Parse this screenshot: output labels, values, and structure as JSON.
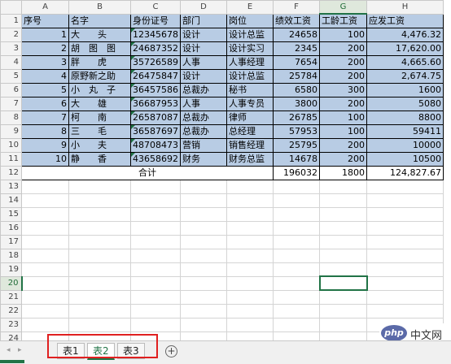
{
  "columns": [
    "A",
    "B",
    "C",
    "D",
    "E",
    "F",
    "G",
    "H"
  ],
  "header": [
    "序号",
    "名字",
    "身份证号",
    "部门",
    "岗位",
    "绩效工资",
    "工龄工资",
    "应发工资"
  ],
  "rows": [
    {
      "no": "1",
      "name": "大　　头",
      "id": "12345678",
      "dept": "设计",
      "post": "设计总监",
      "perf": "24658",
      "senior": "100",
      "pay": "4,476.32"
    },
    {
      "no": "2",
      "name": "胡　图　图",
      "id": "24687352",
      "dept": "设计",
      "post": "设计实习",
      "perf": "2345",
      "senior": "200",
      "pay": "17,620.00"
    },
    {
      "no": "3",
      "name": "胖　　虎",
      "id": "35726589",
      "dept": "人事",
      "post": "人事经理",
      "perf": "7654",
      "senior": "200",
      "pay": "4,665.60"
    },
    {
      "no": "4",
      "name": "原野新之助",
      "id": "26475847",
      "dept": "设计",
      "post": "设计总监",
      "perf": "25784",
      "senior": "200",
      "pay": "2,674.75"
    },
    {
      "no": "5",
      "name": "小　丸　子",
      "id": "36457586",
      "dept": "总裁办",
      "post": "秘书",
      "perf": "6580",
      "senior": "300",
      "pay": "1600"
    },
    {
      "no": "6",
      "name": "大　　雄",
      "id": "36687953",
      "dept": "人事",
      "post": "人事专员",
      "perf": "3800",
      "senior": "200",
      "pay": "5080"
    },
    {
      "no": "7",
      "name": "柯　　南",
      "id": "26587087",
      "dept": "总裁办",
      "post": "律师",
      "perf": "26785",
      "senior": "100",
      "pay": "8800"
    },
    {
      "no": "8",
      "name": "三　　毛",
      "id": "36587697",
      "dept": "总裁办",
      "post": "总经理",
      "perf": "57953",
      "senior": "100",
      "pay": "59411"
    },
    {
      "no": "9",
      "name": "小　　夫",
      "id": "48708473",
      "dept": "营销",
      "post": "销售经理",
      "perf": "25795",
      "senior": "200",
      "pay": "10000"
    },
    {
      "no": "10",
      "name": "静　　香",
      "id": "43658692",
      "dept": "财务",
      "post": "财务总监",
      "perf": "14678",
      "senior": "200",
      "pay": "10500"
    }
  ],
  "total": {
    "label": "合计",
    "perf": "196032",
    "senior": "1800",
    "pay": "124,827.67"
  },
  "row_numbers": [
    "1",
    "2",
    "3",
    "4",
    "5",
    "6",
    "7",
    "8",
    "9",
    "10",
    "11",
    "12",
    "13",
    "14",
    "15",
    "16",
    "17",
    "18",
    "19",
    "20",
    "21",
    "22",
    "23",
    "24"
  ],
  "selected_column": "G",
  "selected_row": "20",
  "sheet_tabs": [
    "表1",
    "表2",
    "表3"
  ],
  "active_tab": "表2",
  "add_sheet_label": "+",
  "nav_left": "◂",
  "nav_right": "▸",
  "watermark": {
    "logo": "php",
    "text": "中文网"
  },
  "colors": {
    "header_fill": "#b8cce4",
    "accent": "#217346",
    "tab_highlight": "#e02020"
  }
}
